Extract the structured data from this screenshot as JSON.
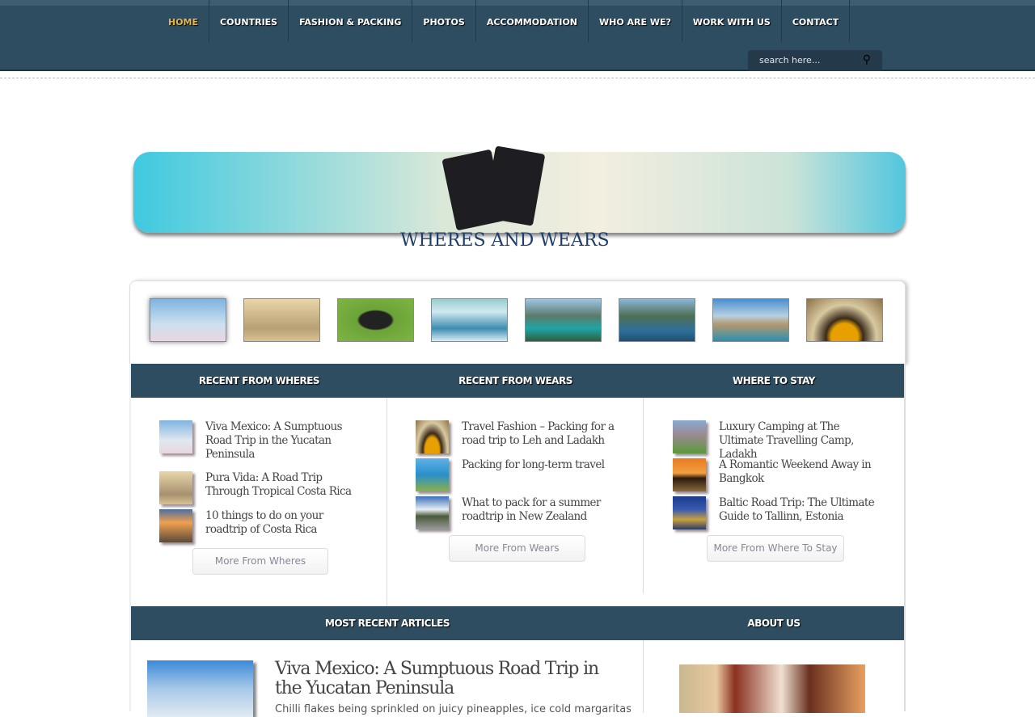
{
  "nav": {
    "items": [
      "HOME",
      "COUNTRIES",
      "FASHION & PACKING",
      "PHOTOS",
      "ACCOMMODATION",
      "WHO ARE WE?",
      "WORK WITH US",
      "CONTACT"
    ],
    "active": "HOME"
  },
  "search": {
    "placeholder": "search here..."
  },
  "logo": {
    "title": "Bruised Passports",
    "tagline": "WHERES AND WEARS"
  },
  "sections": {
    "wheres": {
      "title": "RECENT FROM WHERES",
      "items": [
        "Viva Mexico: A Sumptuous Road Trip in the Yucatan Peninsula",
        "Pura Vida: A Road Trip Through Tropical Costa Rica",
        "10 things to do on your roadtrip of Costa Rica"
      ],
      "more": "More From Wheres"
    },
    "wears": {
      "title": "RECENT FROM WEARS",
      "items": [
        "Travel Fashion – Packing for a road trip to Leh and Ladakh",
        "Packing for long-term travel",
        "What to pack for a summer roadtrip in New Zealand"
      ],
      "more": "More From Wears"
    },
    "stay": {
      "title": "WHERE TO STAY",
      "items": [
        "Luxury Camping at The Ultimate Travelling Camp, Ladakh",
        "A Romantic Weekend Away in Bangkok",
        "Baltic Road Trip: The Ultimate Guide to Tallinn, Estonia"
      ],
      "more": "More From Where To Stay"
    }
  },
  "recent": {
    "title": "MOST RECENT ARTICLES",
    "article_title": "Viva Mexico: A Sumptuous Road Trip in the Yucatan Peninsula",
    "excerpt": "Chilli flakes being sprinkled on juicy pineapples, ice cold margaritas"
  },
  "about": {
    "title": "ABOUT US"
  }
}
